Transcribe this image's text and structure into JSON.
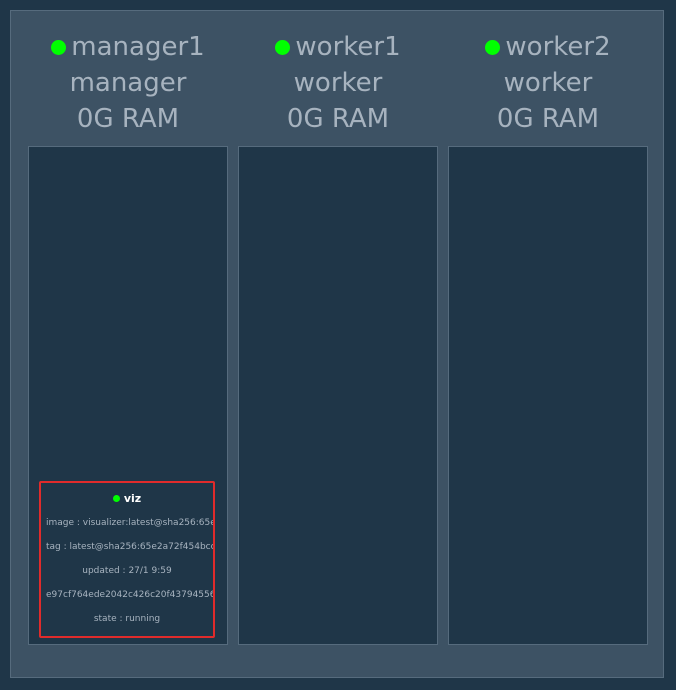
{
  "nodes": [
    {
      "name": "manager1",
      "role": "manager",
      "ram": "0G RAM",
      "status_color": "#00ff00",
      "tasks": [
        {
          "name": "viz",
          "image": "image : visualizer:latest@sha256:65e",
          "tag": "tag : latest@sha256:65e2a72f454bcc",
          "updated": "updated : 27/1 9:59",
          "id": "e97cf764ede2042c426c20f43794556",
          "state": "state : running",
          "status_color": "#00ff00",
          "border_color": "#e02b2b"
        }
      ]
    },
    {
      "name": "worker1",
      "role": "worker",
      "ram": "0G RAM",
      "status_color": "#00ff00",
      "tasks": []
    },
    {
      "name": "worker2",
      "role": "worker",
      "ram": "0G RAM",
      "status_color": "#00ff00",
      "tasks": []
    }
  ]
}
